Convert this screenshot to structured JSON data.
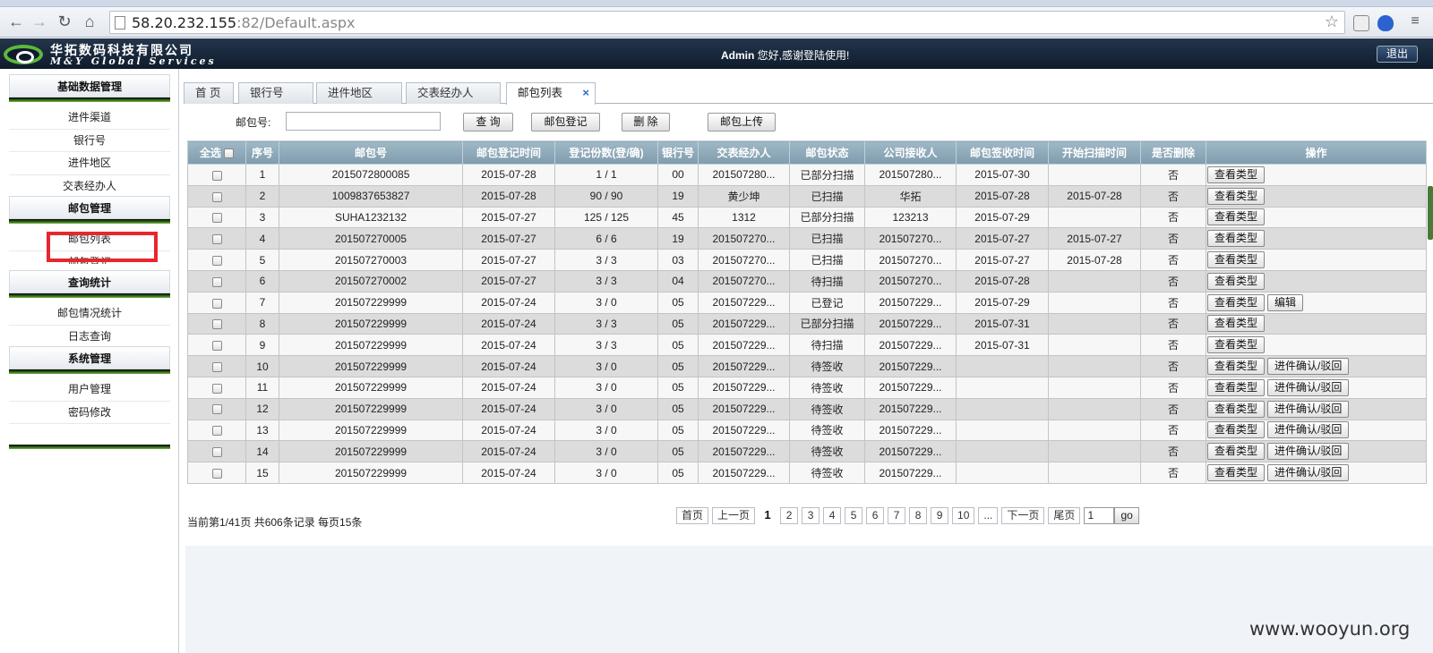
{
  "browser": {
    "url_host": "58.20.232.155",
    "url_rest": ":82/Default.aspx"
  },
  "header": {
    "company_cn": "华拓数码科技有限公司",
    "company_en": "M&Y Global Services",
    "welcome_user": "Admin",
    "welcome_text": " 您好,感谢登陆使用!",
    "logout": "退出"
  },
  "sidebar": {
    "sections": [
      {
        "title": "基础数据管理",
        "items": [
          "进件渠道",
          "银行号",
          "进件地区",
          "交表经办人"
        ]
      },
      {
        "title": "邮包管理",
        "items": [
          "邮包列表",
          "邮包登记"
        ]
      },
      {
        "title": "查询统计",
        "items": [
          "邮包情况统计",
          "日志查询"
        ]
      },
      {
        "title": "系统管理",
        "items": [
          "用户管理",
          "密码修改"
        ]
      }
    ]
  },
  "tabs": [
    {
      "label": "首 页"
    },
    {
      "label": "银行号"
    },
    {
      "label": "进件地区"
    },
    {
      "label": "交表经办人"
    },
    {
      "label": "邮包列表",
      "close": "×"
    }
  ],
  "search": {
    "label": "邮包号:",
    "value": "",
    "buttons": [
      "查 询",
      "邮包登记",
      "删 除",
      "邮包上传"
    ]
  },
  "table": {
    "columns": [
      "全选",
      "序号",
      "邮包号",
      "邮包登记时间",
      "登记份数(登/确)",
      "银行号",
      "交表经办人",
      "邮包状态",
      "公司接收人",
      "邮包签收时间",
      "开始扫描时间",
      "是否删除",
      "操作"
    ],
    "rows": [
      [
        "1",
        "2015072800085",
        "2015-07-28",
        "1 / 1",
        "00",
        "201507280...",
        "已部分扫描",
        "201507280...",
        "2015-07-30",
        "",
        "否",
        [
          "查看类型"
        ]
      ],
      [
        "2",
        "1009837653827",
        "2015-07-28",
        "90 / 90",
        "19",
        "黄少坤",
        "已扫描",
        "华拓",
        "2015-07-28",
        "2015-07-28",
        "否",
        [
          "查看类型"
        ]
      ],
      [
        "3",
        "SUHA1232132",
        "2015-07-27",
        "125 / 125",
        "45",
        "1312",
        "已部分扫描",
        "123213",
        "2015-07-29",
        "",
        "否",
        [
          "查看类型"
        ]
      ],
      [
        "4",
        "201507270005",
        "2015-07-27",
        "6 / 6",
        "19",
        "201507270...",
        "已扫描",
        "201507270...",
        "2015-07-27",
        "2015-07-27",
        "否",
        [
          "查看类型"
        ]
      ],
      [
        "5",
        "201507270003",
        "2015-07-27",
        "3 / 3",
        "03",
        "201507270...",
        "已扫描",
        "201507270...",
        "2015-07-27",
        "2015-07-28",
        "否",
        [
          "查看类型"
        ]
      ],
      [
        "6",
        "201507270002",
        "2015-07-27",
        "3 / 3",
        "04",
        "201507270...",
        "待扫描",
        "201507270...",
        "2015-07-28",
        "",
        "否",
        [
          "查看类型"
        ]
      ],
      [
        "7",
        "201507229999",
        "2015-07-24",
        "3 / 0",
        "05",
        "201507229...",
        "已登记",
        "201507229...",
        "2015-07-29",
        "",
        "否",
        [
          "查看类型",
          "编辑"
        ]
      ],
      [
        "8",
        "201507229999",
        "2015-07-24",
        "3 / 3",
        "05",
        "201507229...",
        "已部分扫描",
        "201507229...",
        "2015-07-31",
        "",
        "否",
        [
          "查看类型"
        ]
      ],
      [
        "9",
        "201507229999",
        "2015-07-24",
        "3 / 3",
        "05",
        "201507229...",
        "待扫描",
        "201507229...",
        "2015-07-31",
        "",
        "否",
        [
          "查看类型"
        ]
      ],
      [
        "10",
        "201507229999",
        "2015-07-24",
        "3 / 0",
        "05",
        "201507229...",
        "待签收",
        "201507229...",
        "",
        "",
        "否",
        [
          "查看类型",
          "进件确认/驳回"
        ]
      ],
      [
        "11",
        "201507229999",
        "2015-07-24",
        "3 / 0",
        "05",
        "201507229...",
        "待签收",
        "201507229...",
        "",
        "",
        "否",
        [
          "查看类型",
          "进件确认/驳回"
        ]
      ],
      [
        "12",
        "201507229999",
        "2015-07-24",
        "3 / 0",
        "05",
        "201507229...",
        "待签收",
        "201507229...",
        "",
        "",
        "否",
        [
          "查看类型",
          "进件确认/驳回"
        ]
      ],
      [
        "13",
        "201507229999",
        "2015-07-24",
        "3 / 0",
        "05",
        "201507229...",
        "待签收",
        "201507229...",
        "",
        "",
        "否",
        [
          "查看类型",
          "进件确认/驳回"
        ]
      ],
      [
        "14",
        "201507229999",
        "2015-07-24",
        "3 / 0",
        "05",
        "201507229...",
        "待签收",
        "201507229...",
        "",
        "",
        "否",
        [
          "查看类型",
          "进件确认/驳回"
        ]
      ],
      [
        "15",
        "201507229999",
        "2015-07-24",
        "3 / 0",
        "05",
        "201507229...",
        "待签收",
        "201507229...",
        "",
        "",
        "否",
        [
          "查看类型",
          "进件确认/驳回"
        ]
      ]
    ]
  },
  "pagination": {
    "info": "当前第1/41页 共606条记录 每页15条",
    "first": "首页",
    "prev": "上一页",
    "pages": [
      "1",
      "2",
      "3",
      "4",
      "5",
      "6",
      "7",
      "8",
      "9",
      "10"
    ],
    "current": "1",
    "ellipsis": "...",
    "next": "下一页",
    "last": "尾页",
    "goto_value": "1",
    "go": "go"
  },
  "watermark": "www.wooyun.org",
  "colors": {
    "header_bg": "#132437",
    "table_header": "#8aa7b7",
    "highlight_box": "#e8262d",
    "menu_accent": "#5db83b"
  }
}
